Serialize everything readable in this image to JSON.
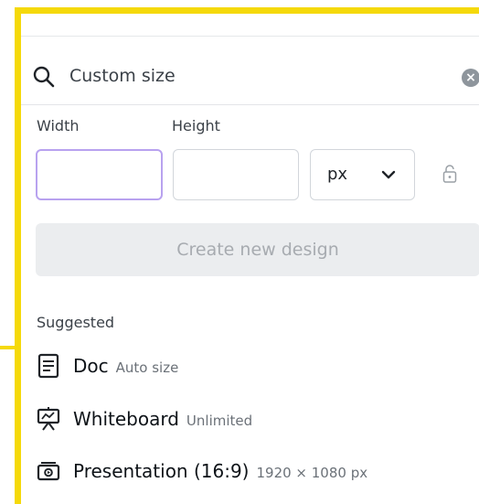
{
  "search": {
    "value": "Custom size"
  },
  "size": {
    "width_label": "Width",
    "height_label": "Height",
    "width_value": "",
    "height_value": "",
    "unit": "px"
  },
  "create_button": "Create new design",
  "suggested": {
    "heading": "Suggested",
    "items": [
      {
        "title": "Doc",
        "subtitle": "Auto size",
        "icon": "doc-icon"
      },
      {
        "title": "Whiteboard",
        "subtitle": "Unlimited",
        "icon": "whiteboard-icon"
      },
      {
        "title": "Presentation (16:9)",
        "subtitle": "1920 × 1080 px",
        "icon": "presentation-icon"
      }
    ]
  },
  "colors": {
    "frame": "#f5d90a",
    "focus_border": "#b8a2ef",
    "disabled_button_bg": "#ebedef",
    "disabled_button_text": "#a7abb0"
  }
}
